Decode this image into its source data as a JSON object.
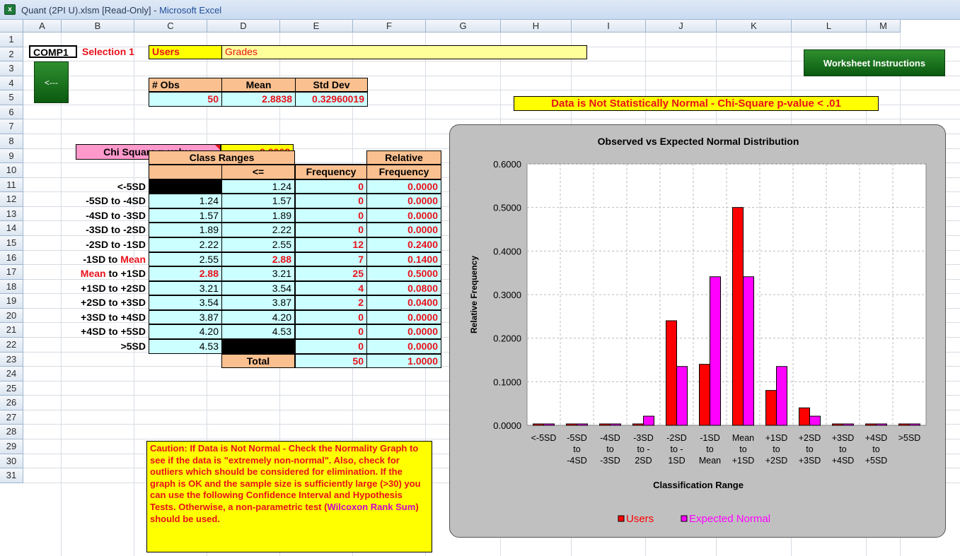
{
  "window": {
    "title_prefix": "Quant (2PI U).xlsm  [Read-Only] - ",
    "title_app": "Microsoft Excel"
  },
  "columns": [
    "A",
    "B",
    "C",
    "D",
    "E",
    "F",
    "G",
    "H",
    "I",
    "J",
    "K",
    "L",
    "M"
  ],
  "rows": [
    "1",
    "2",
    "3",
    "4",
    "5",
    "6",
    "7",
    "8",
    "9",
    "10",
    "11",
    "12",
    "13",
    "14",
    "15",
    "16",
    "17",
    "18",
    "19",
    "20",
    "21",
    "22",
    "23",
    "24",
    "25",
    "26",
    "27",
    "28",
    "29",
    "30",
    "31"
  ],
  "header_row": {
    "comp": "COMP1",
    "selection": "Selection 1",
    "users": "Users",
    "grades": "Grades"
  },
  "back_button": "<---",
  "instructions_button": "Worksheet Instructions",
  "stats": {
    "obs_label": "# Obs",
    "mean_label": "Mean",
    "std_label": "Std Dev",
    "obs_value": "50",
    "mean_value": "2.8838",
    "std_value": "0.32960019"
  },
  "chi": {
    "label": "Chi Square p-value",
    "value": "0.0068"
  },
  "normality_message": "Data is Not Statistically Normal - Chi-Square p-value < .01",
  "freq_table": {
    "class_ranges": "Class Ranges",
    "le": "<=",
    "frequency": "Frequency",
    "relative": "Relative",
    "relative_frequency": "Frequency",
    "total_label": "Total",
    "total_freq": "50",
    "total_rel": "1.0000",
    "rows": [
      {
        "label": "<-5SD",
        "lower": "",
        "upper": "1.24",
        "freq": "0",
        "rel": "0.0000"
      },
      {
        "label": "-5SD to -4SD",
        "lower": "1.24",
        "upper": "1.57",
        "freq": "0",
        "rel": "0.0000"
      },
      {
        "label": "-4SD to -3SD",
        "lower": "1.57",
        "upper": "1.89",
        "freq": "0",
        "rel": "0.0000"
      },
      {
        "label": "-3SD to -2SD",
        "lower": "1.89",
        "upper": "2.22",
        "freq": "0",
        "rel": "0.0000"
      },
      {
        "label": "-2SD to -1SD",
        "lower": "2.22",
        "upper": "2.55",
        "freq": "12",
        "rel": "0.2400"
      },
      {
        "label": "-1SD to ",
        "label_red": "Mean",
        "lower": "2.55",
        "upper": "2.88",
        "freq": "7",
        "rel": "0.1400"
      },
      {
        "label_red_pre": "Mean",
        "label": " to +1SD",
        "lower": "2.88",
        "upper": "3.21",
        "freq": "25",
        "rel": "0.5000"
      },
      {
        "label": "+1SD to +2SD",
        "lower": "3.21",
        "upper": "3.54",
        "freq": "4",
        "rel": "0.0800"
      },
      {
        "label": "+2SD to +3SD",
        "lower": "3.54",
        "upper": "3.87",
        "freq": "2",
        "rel": "0.0400"
      },
      {
        "label": "+3SD to +4SD",
        "lower": "3.87",
        "upper": "4.20",
        "freq": "0",
        "rel": "0.0000"
      },
      {
        "label": "+4SD to +5SD",
        "lower": "4.20",
        "upper": "4.53",
        "freq": "0",
        "rel": "0.0000"
      },
      {
        "label": ">5SD",
        "lower": "4.53",
        "upper": "",
        "freq": "0",
        "rel": "0.0000"
      }
    ]
  },
  "caution": {
    "text1": "Caution:  If Data is Not Normal - Check the Normality Graph to see if the data is \"extremely non-normal\".  Also, check for outliers which should be considered for elimination.  If the graph is OK and the sample size is sufficiently large (>30) you can use the following Confidence Interval and Hypothesis Tests.  Otherwise, a non-parametric test (",
    "link": "Wilcoxon Rank Sum",
    "text2": ") should be used."
  },
  "colors": {
    "tan": "#fac090",
    "cyan": "#ccffff",
    "yellow": "#ffff00",
    "light_yellow": "#ffff99",
    "pink": "#ff99cc",
    "users": "#ff0000",
    "expected": "#ff00ff",
    "link": "#cc00cc"
  },
  "chart_data": {
    "type": "bar",
    "title": "Observed vs Expected Normal Distribution",
    "xlabel": "Classification Range",
    "ylabel": "Relative Frequency",
    "ylim": [
      0,
      0.6
    ],
    "yticks": [
      "0.0000",
      "0.1000",
      "0.2000",
      "0.3000",
      "0.4000",
      "0.5000",
      "0.6000"
    ],
    "categories": [
      [
        "<-5SD"
      ],
      [
        "-5SD",
        "to",
        "-4SD"
      ],
      [
        "-4SD",
        "to",
        "-3SD"
      ],
      [
        "-3SD",
        "to -",
        "2SD"
      ],
      [
        "-2SD",
        "to -",
        "1SD"
      ],
      [
        "-1SD",
        "to",
        "Mean"
      ],
      [
        "Mean",
        "to",
        "+1SD"
      ],
      [
        "+1SD",
        "to",
        "+2SD"
      ],
      [
        "+2SD",
        "to",
        "+3SD"
      ],
      [
        "+3SD",
        "to",
        "+4SD"
      ],
      [
        "+4SD",
        "to",
        "+5SD"
      ],
      [
        ">5SD"
      ]
    ],
    "series": [
      {
        "name": "Users",
        "values": [
          0,
          0,
          0,
          0,
          0.24,
          0.14,
          0.5,
          0.08,
          0.04,
          0,
          0,
          0
        ]
      },
      {
        "name": "Expected Normal",
        "values": [
          0,
          0,
          0.001,
          0.021,
          0.135,
          0.341,
          0.341,
          0.135,
          0.021,
          0.001,
          0,
          0
        ]
      }
    ],
    "legend": "bottom",
    "grid": true
  }
}
